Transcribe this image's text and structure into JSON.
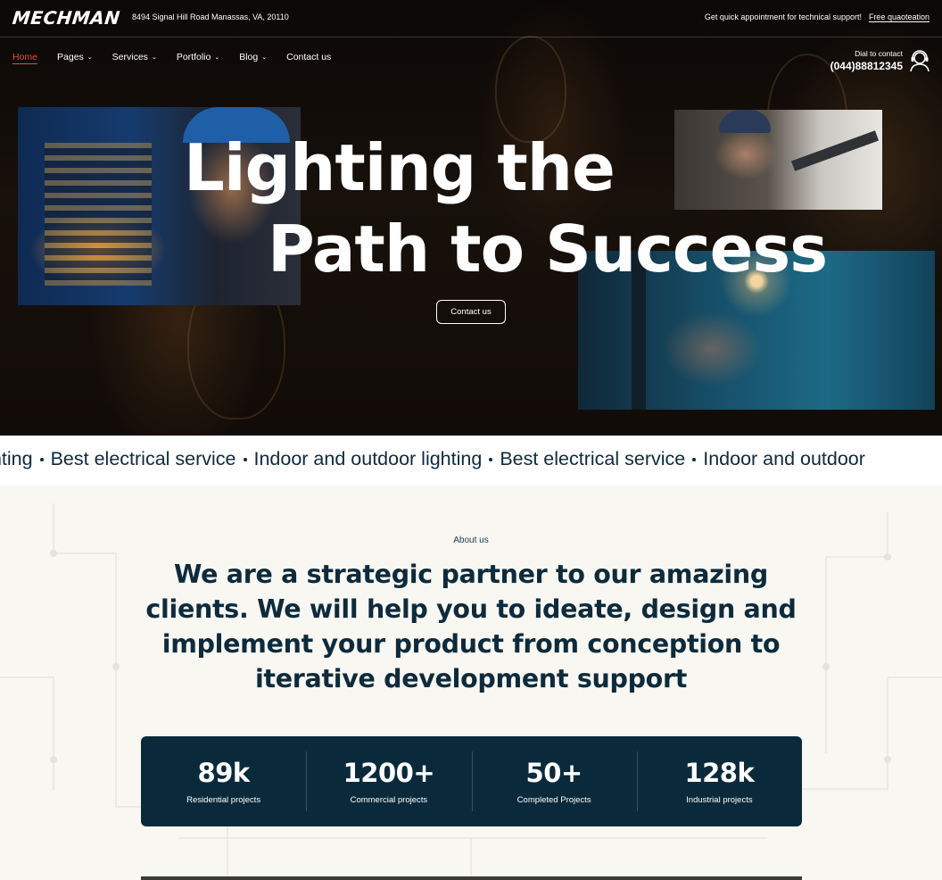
{
  "brand": {
    "logo_text": "MECHMAN"
  },
  "topbar": {
    "address": "8494 Signal Hill Road Manassas, VA, 20110",
    "support_text": "Get quick appointment for technical support!",
    "quote_link": "Free quaoteation"
  },
  "nav": {
    "items": [
      {
        "label": "Home",
        "active": true
      },
      {
        "label": "Pages",
        "has_dropdown": true
      },
      {
        "label": "Services",
        "has_dropdown": true
      },
      {
        "label": "Portfolio",
        "has_dropdown": true
      },
      {
        "label": "Blog",
        "has_dropdown": true
      },
      {
        "label": "Contact us"
      }
    ]
  },
  "dial": {
    "label": "Dial to contact",
    "number": "(044)88812345"
  },
  "hero": {
    "title_line1": "Lighting the",
    "title_line2": "Path to Success",
    "cta_label": "Contact us"
  },
  "marquee": {
    "items": [
      "ghting",
      "Best electrical service",
      "Indoor and outdoor lighting",
      "Best electrical service",
      "Indoor and outdoor"
    ]
  },
  "about": {
    "label": "About us",
    "heading": "We are a strategic partner to our amazing clients. We will help you to ideate, design and implement your product from conception to iterative development support"
  },
  "stats": [
    {
      "value": "89k",
      "label": "Residential projects"
    },
    {
      "value": "1200+",
      "label": "Commercial projects"
    },
    {
      "value": "50+",
      "label": "Completed Projects"
    },
    {
      "value": "128k",
      "label": "Industrial projects"
    }
  ],
  "colors": {
    "accent": "#e8493a",
    "navy": "#0a2a3b",
    "cream": "#f8f7f1"
  }
}
